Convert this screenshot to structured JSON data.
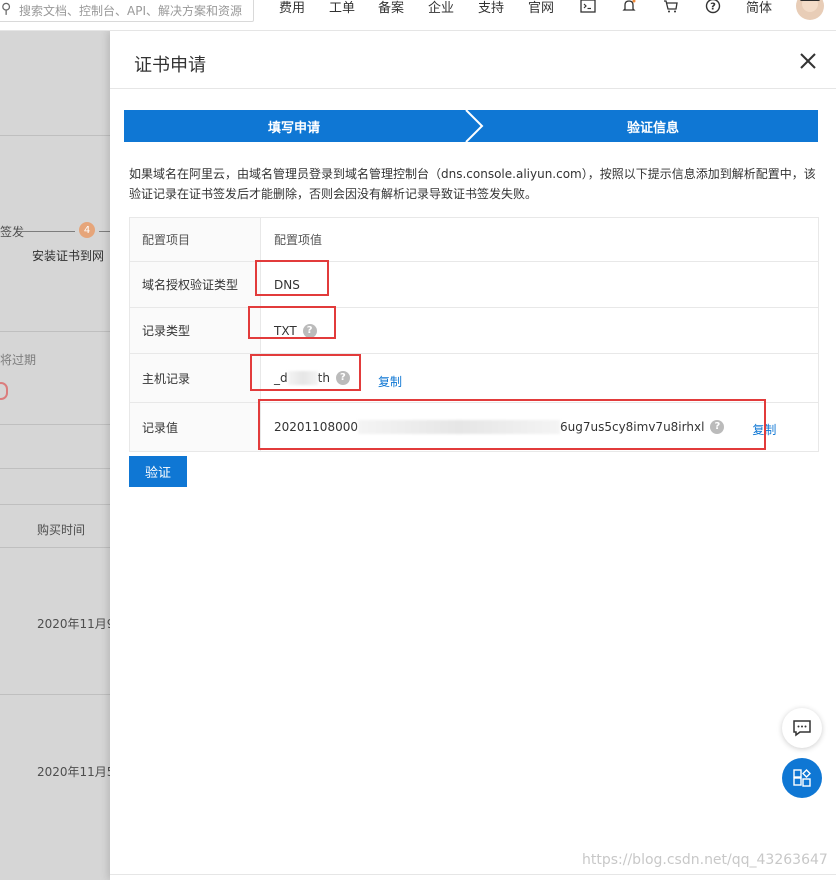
{
  "topnav": {
    "search_placeholder": "搜索文档、控制台、API、解决方案和资源",
    "items": [
      "费用",
      "工单",
      "备案",
      "企业",
      "支持",
      "官网"
    ],
    "lang": "简体",
    "icons": [
      "terminal-icon",
      "bell-icon",
      "cart-icon",
      "help-icon"
    ]
  },
  "background": {
    "step_fragment": "签发",
    "step4_number": "4",
    "step4_label": "安装证书到网",
    "expire_text": "将过期",
    "col_buy_time": "购买时间",
    "date1": "2020年11月9",
    "date2": "2020年11月5"
  },
  "drawer": {
    "title": "证书申请",
    "steps": [
      "填写申请",
      "验证信息"
    ],
    "description": "如果域名在阿里云，由域名管理员登录到域名管理控制台（dns.console.aliyun.com），按照以下提示信息添加到解析配置中，该验证记录在证书签发后才能删除，否则会因没有解析记录导致证书签发失败。",
    "table": {
      "headers": [
        "配置项目",
        "配置项值"
      ],
      "rows": [
        {
          "label": "域名授权验证类型",
          "value": "DNS"
        },
        {
          "label": "记录类型",
          "value": "TXT"
        },
        {
          "label": "主机记录",
          "value_start": "_d",
          "value_end": "th",
          "copy": "复制"
        },
        {
          "label": "记录值",
          "value_start": "20201108000",
          "value_end": "6ug7us5cy8imv7u8irhxl",
          "copy": "复制"
        }
      ]
    },
    "verify_button": "验证"
  },
  "watermark": "https://blog.csdn.net/qq_43263647",
  "colors": {
    "primary": "#0f77d4",
    "highlight": "#e23b3b"
  }
}
